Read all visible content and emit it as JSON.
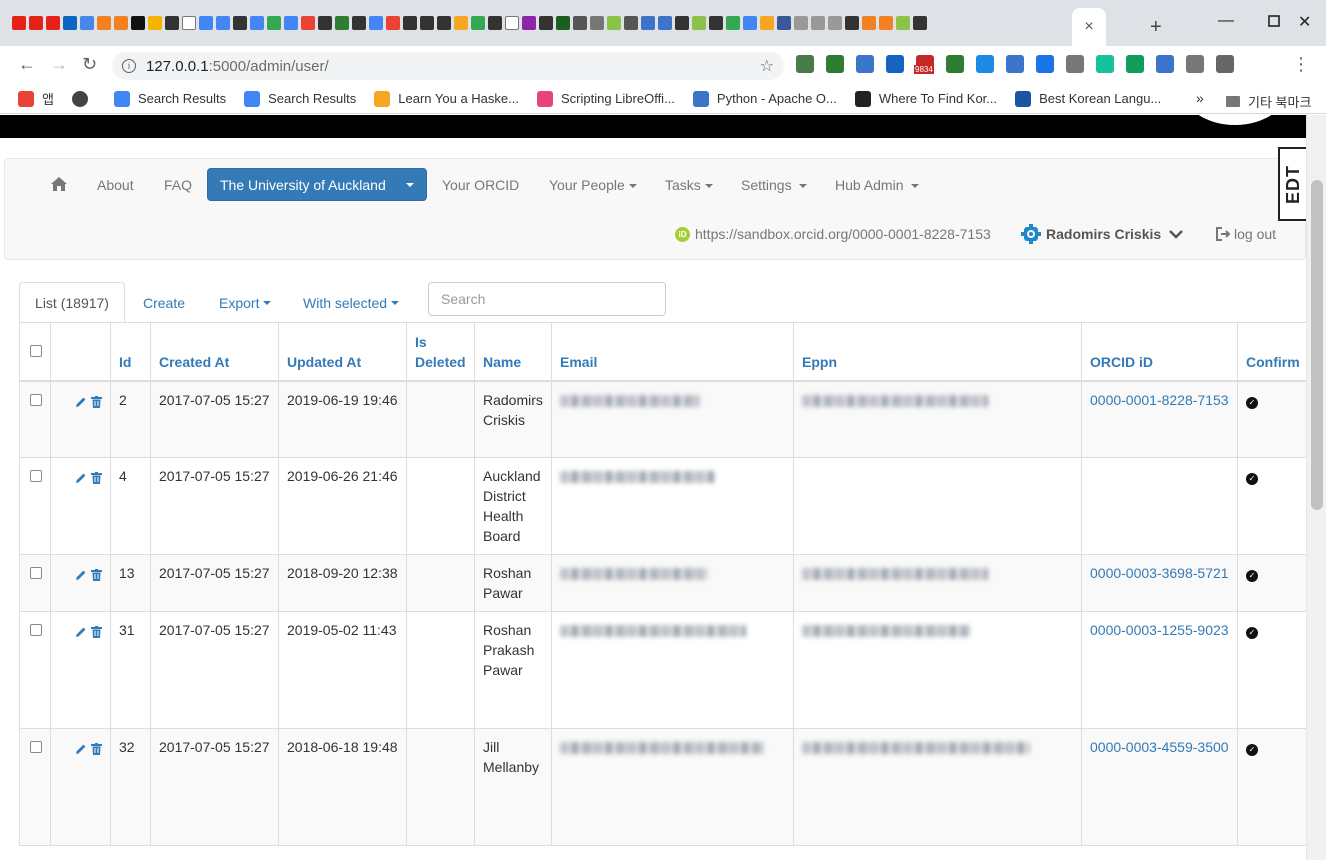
{
  "browser": {
    "url_host": "127.0.0.1",
    "url_path": ":5000/admin/user/",
    "new_tab": "+",
    "active_tab_close": "×",
    "ext_badge": "9834",
    "bookmarks": [
      {
        "label": "앱",
        "color": "#ea4335"
      },
      {
        "label": "",
        "color": "#444444"
      },
      {
        "label": "Search Results",
        "color": "#4285f4"
      },
      {
        "label": "Search Results",
        "color": "#4285f4"
      },
      {
        "label": "Learn You a Haske...",
        "color": "#f5a623"
      },
      {
        "label": "Scripting LibreOffi...",
        "color": "#e8437b"
      },
      {
        "label": "Python - Apache O...",
        "color": "#3b74c9"
      },
      {
        "label": "Where To Find Kor...",
        "color": "#222222"
      },
      {
        "label": "Best Korean Langu...",
        "color": "#1a55a4"
      }
    ],
    "bookmarks_more": "»",
    "other_bookmarks": "기타 북마크"
  },
  "nav": {
    "about": "About",
    "faq": "FAQ",
    "organisation": "The University of Auckland",
    "your_orcid": "Your ORCID",
    "your_people": "Your People",
    "tasks": "Tasks",
    "settings": "Settings",
    "hub_admin": "Hub Admin",
    "orcid_url": "https://sandbox.orcid.org/0000-0001-8228-7153",
    "user_name": "Radomirs Criskis",
    "logout": "log out",
    "edt": "EDT"
  },
  "tabs": {
    "list": "List (18917)",
    "create": "Create",
    "export": "Export",
    "with_selected": "With selected"
  },
  "search": {
    "placeholder": "Search"
  },
  "table": {
    "headers": {
      "id": "Id",
      "created_at": "Created At",
      "updated_at": "Updated At",
      "is_deleted": "Is Deleted",
      "name": "Name",
      "email": "Email",
      "eppn": "Eppn",
      "orcid": "ORCID iD",
      "confirmed": "Confirm"
    },
    "rows": [
      {
        "id": "2",
        "created": "2017-07-05 15:27",
        "updated": "2019-06-19 19:46",
        "name": "Radomirs Criskis",
        "orcid": "0000-0001-8228-7153",
        "confirmed": true
      },
      {
        "id": "4",
        "created": "2017-07-05 15:27",
        "updated": "2019-06-26 21:46",
        "name": "Auckland District Health Board",
        "orcid": "",
        "confirmed": true
      },
      {
        "id": "13",
        "created": "2017-07-05 15:27",
        "updated": "2018-09-20 12:38",
        "name": "Roshan Pawar",
        "orcid": "0000-0003-3698-5721",
        "confirmed": true
      },
      {
        "id": "31",
        "created": "2017-07-05 15:27",
        "updated": "2019-05-02 11:43",
        "name": "Roshan Prakash Pawar",
        "orcid": "0000-0003-1255-9023",
        "confirmed": true
      },
      {
        "id": "32",
        "created": "2017-07-05 15:27",
        "updated": "2018-06-18 19:48",
        "name": "Jill Mellanby",
        "orcid": "0000-0003-4559-3500",
        "confirmed": true
      }
    ]
  }
}
